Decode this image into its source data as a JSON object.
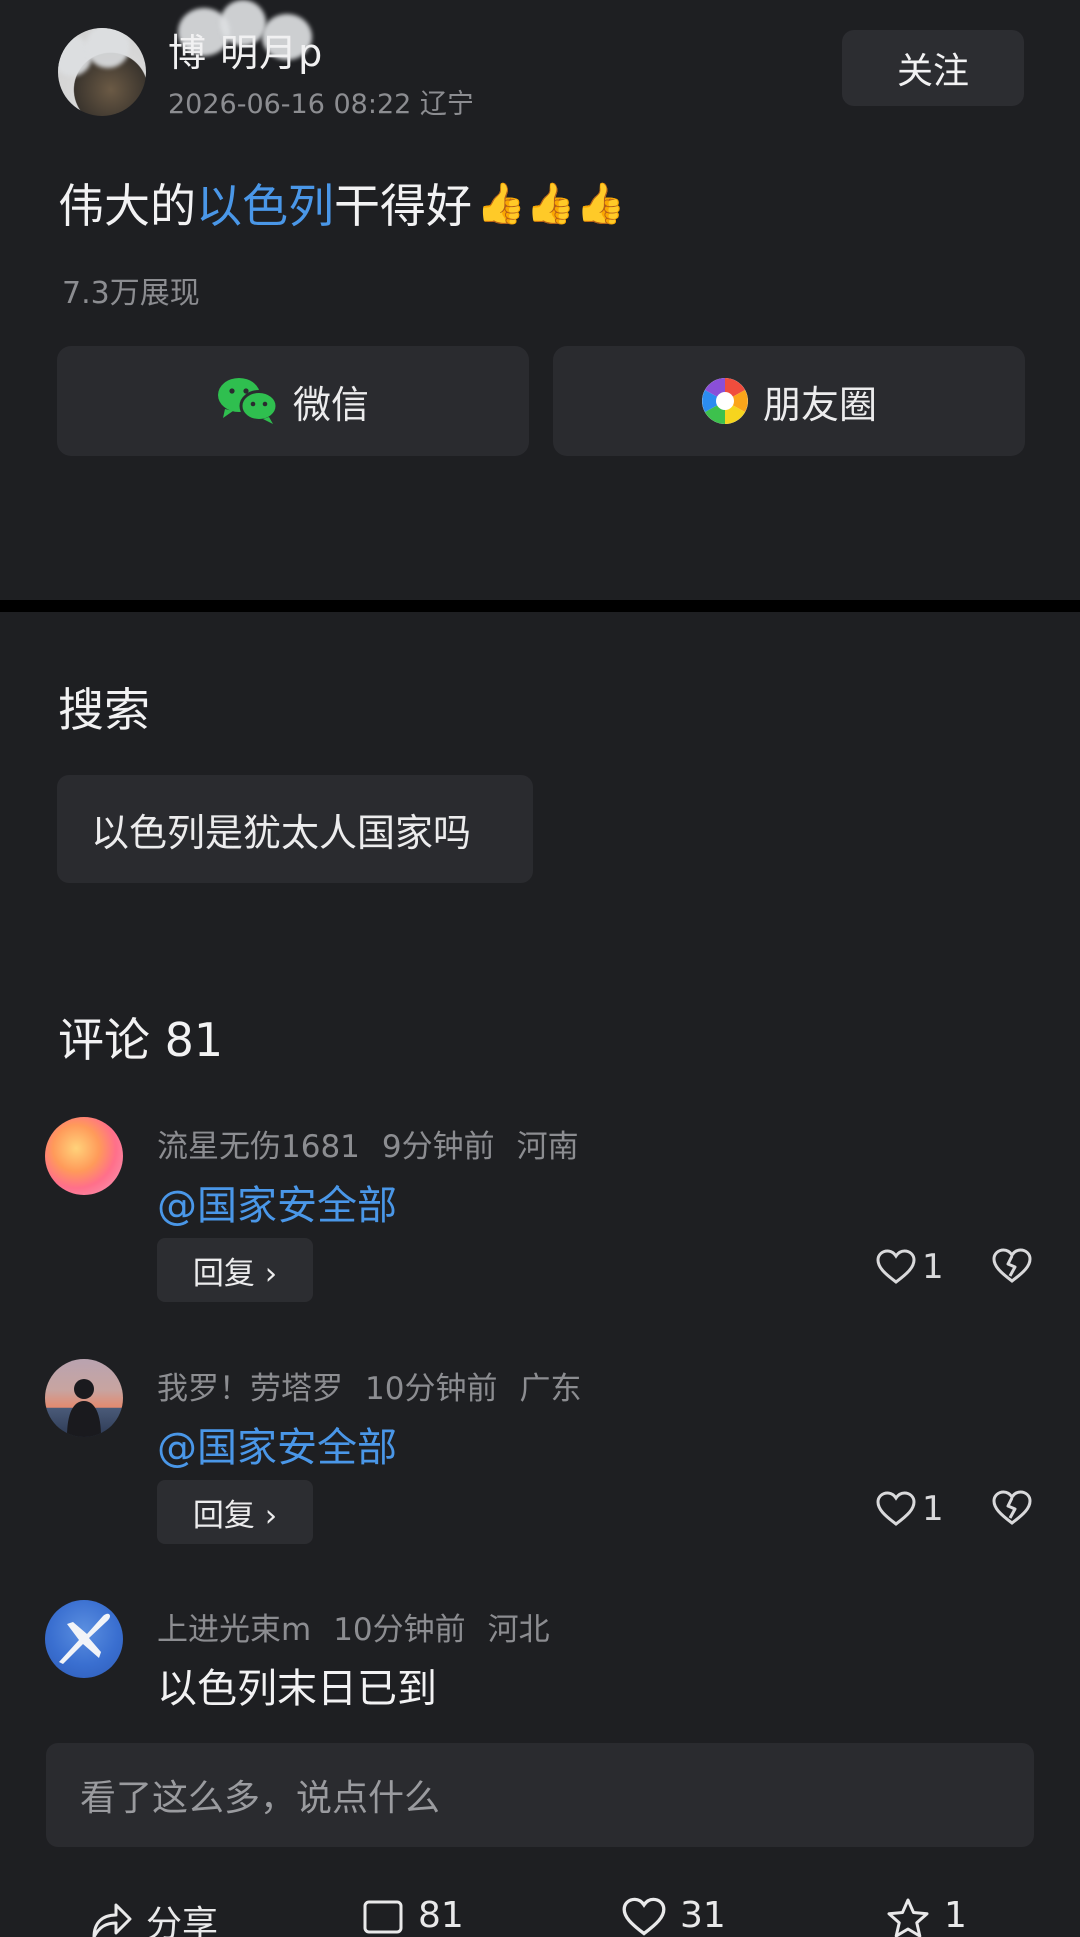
{
  "post": {
    "author": "博       明月p",
    "meta": "2026-06-16 08:22 辽宁",
    "follow_label": "关注",
    "text_before": "伟大的",
    "text_link": "以色列",
    "text_after": "干得好",
    "thumbs": "👍👍👍",
    "views": "7.3万展现",
    "share_wechat": "微信",
    "share_moments": "朋友圈"
  },
  "search": {
    "title": "搜索",
    "suggestion": "以色列是犹太人国家吗"
  },
  "comments_header": "评论 81",
  "comments": [
    {
      "user": "流星无伤1681",
      "time": "9分钟前",
      "location": "河南",
      "text": "@国家安全部",
      "reply_label": "回复 ›",
      "likes": "1"
    },
    {
      "user": "我罗！劳塔罗",
      "time": "10分钟前",
      "location": "广东",
      "text": "@国家安全部",
      "reply_label": "回复 ›",
      "likes": "1"
    },
    {
      "user": "上进光束m",
      "time": "10分钟前",
      "location": "河北",
      "text": "以色列末日已到"
    }
  ],
  "input_placeholder": "看了这么多，说点什么",
  "bottom_bar": {
    "share_label": "分享",
    "comments_count": "81",
    "likes_count": "31",
    "favorites_count": "1"
  },
  "colors": {
    "background": "#1e1f22",
    "card": "#2a2b2f",
    "link": "#4a97e8",
    "muted_text": "#8c8d91"
  }
}
